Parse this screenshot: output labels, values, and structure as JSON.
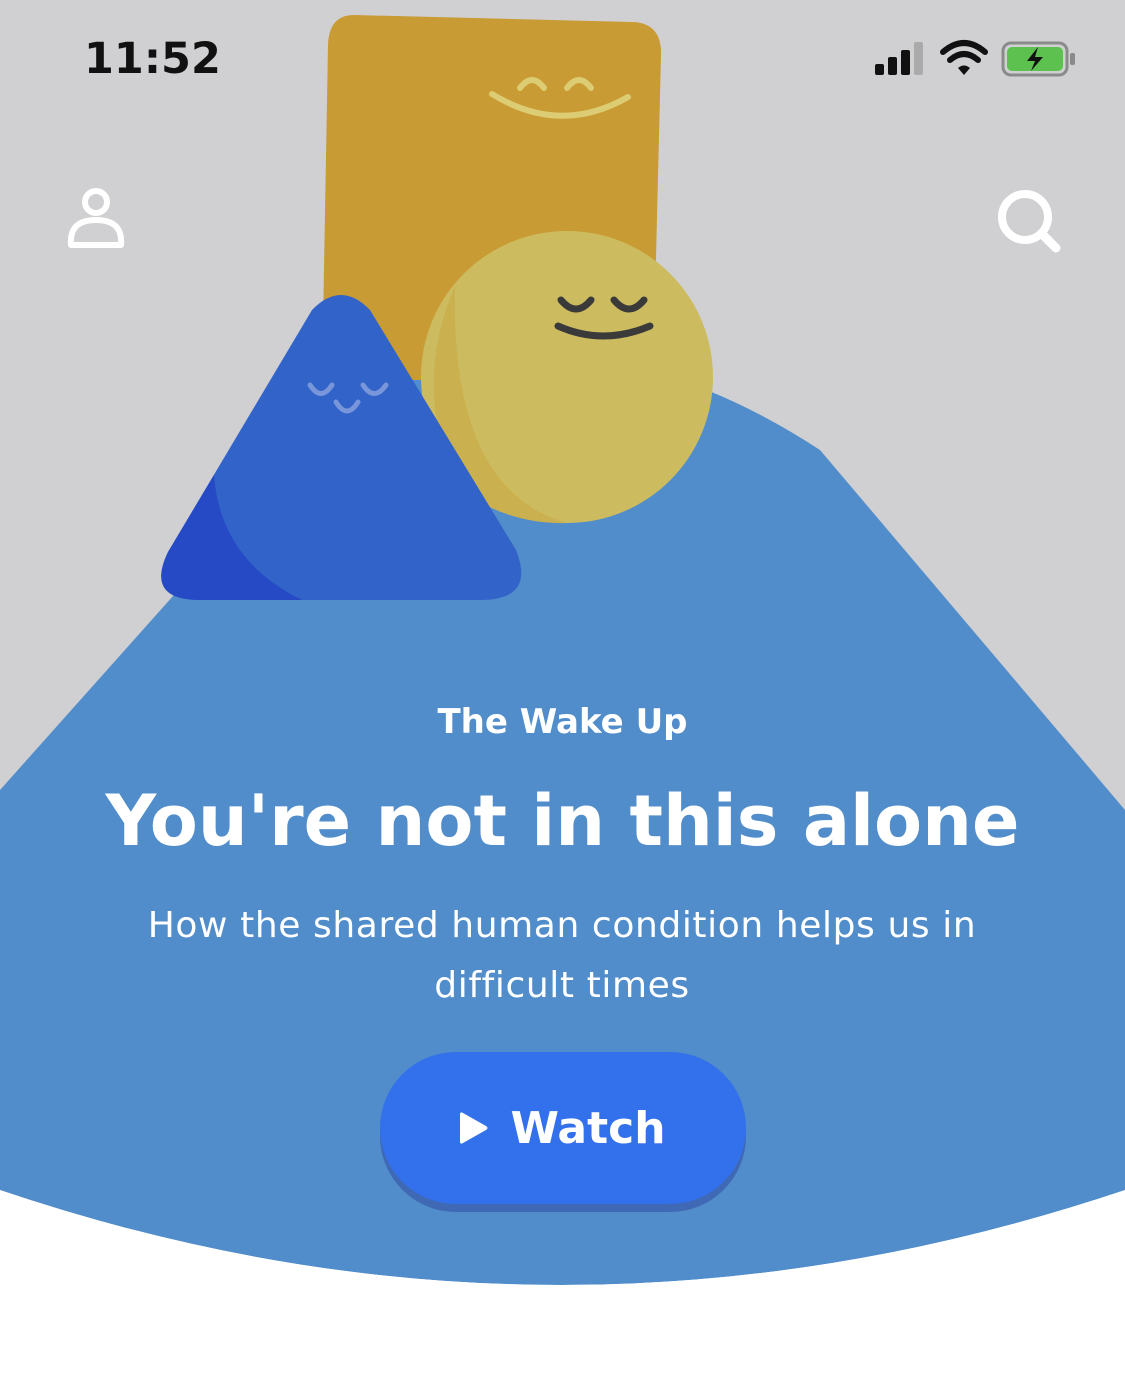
{
  "status_bar": {
    "time": "11:52",
    "icons": [
      "cellular-signal-icon",
      "wifi-icon",
      "battery-charging-icon"
    ]
  },
  "nav": {
    "profile_icon": "person-outline-icon",
    "search_icon": "search-icon"
  },
  "hero": {
    "eyebrow": "The Wake Up",
    "title": "You're not in this alone",
    "subtitle": "How the shared human condition helps us in difficult times",
    "cta_label": "Watch",
    "cta_icon": "play-icon"
  },
  "colors": {
    "sky": "#d0d0d3",
    "hill": "#508dca",
    "rectangle_character": "#c99b34",
    "circle_character": "#cdbc5f",
    "triangle_character": "#3263c8",
    "button": "#3370eb",
    "battery_fill": "#5cc14f"
  }
}
